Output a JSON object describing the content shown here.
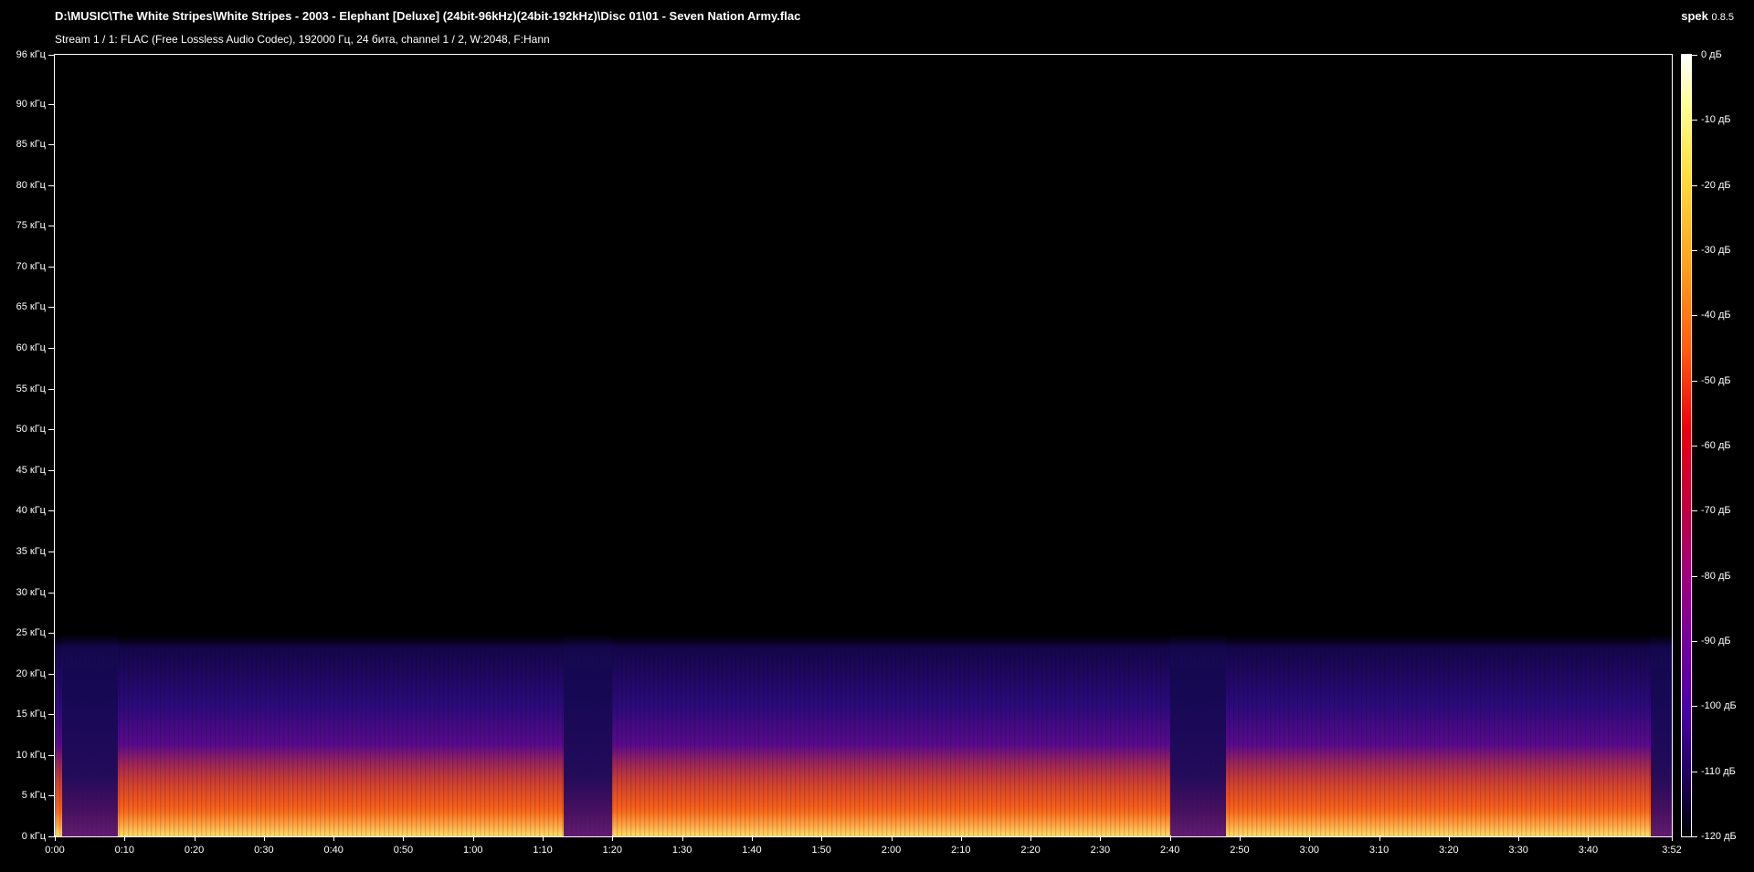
{
  "header": {
    "file_path": "D:\\MUSIC\\The White Stripes\\White Stripes - 2003 - Elephant [Deluxe] (24bit-96kHz)(24bit-192kHz)\\Disc 01\\01 - Seven Nation Army.flac",
    "stream_info": "Stream 1 / 1: FLAC (Free Lossless Audio Codec), 192000 Гц, 24 бита, channel 1 / 2, W:2048, F:Hann",
    "app_name": "spek",
    "app_version": "0.8.5"
  },
  "chart_data": {
    "type": "heatmap",
    "title": "",
    "xlabel": "",
    "ylabel": "",
    "x_ticks": [
      "0:00",
      "0:10",
      "0:20",
      "0:30",
      "0:40",
      "0:50",
      "1:00",
      "1:10",
      "1:20",
      "1:30",
      "1:40",
      "1:50",
      "2:00",
      "2:10",
      "2:20",
      "2:30",
      "2:40",
      "2:50",
      "3:00",
      "3:10",
      "3:20",
      "3:30",
      "3:40",
      "3:52"
    ],
    "x_tick_seconds": [
      0,
      10,
      20,
      30,
      40,
      50,
      60,
      70,
      80,
      90,
      100,
      110,
      120,
      130,
      140,
      150,
      160,
      170,
      180,
      190,
      200,
      210,
      220,
      232
    ],
    "xlim_seconds": [
      0,
      232
    ],
    "y_ticks": [
      "0 кГц",
      "5 кГц",
      "10 кГц",
      "15 кГц",
      "20 кГц",
      "25 кГц",
      "30 кГц",
      "35 кГц",
      "40 кГц",
      "45 кГц",
      "50 кГц",
      "55 кГц",
      "60 кГц",
      "65 кГц",
      "70 кГц",
      "75 кГц",
      "80 кГц",
      "85 кГц",
      "90 кГц",
      "96 кГц"
    ],
    "y_tick_khz": [
      0,
      5,
      10,
      15,
      20,
      25,
      30,
      35,
      40,
      45,
      50,
      55,
      60,
      65,
      70,
      75,
      80,
      85,
      90,
      96
    ],
    "ylim_khz": [
      0,
      96
    ],
    "content_cutoff_khz": 25,
    "quiet_sections_seconds": [
      [
        1,
        9
      ],
      [
        73,
        80
      ],
      [
        160,
        168
      ],
      [
        229,
        232
      ]
    ],
    "colorbar": {
      "labels": [
        "0 дБ",
        "-10 дБ",
        "-20 дБ",
        "-30 дБ",
        "-40 дБ",
        "-50 дБ",
        "-60 дБ",
        "-70 дБ",
        "-80 дБ",
        "-90 дБ",
        "-100 дБ",
        "-110 дБ",
        "-120 дБ"
      ],
      "values_db": [
        0,
        -10,
        -20,
        -30,
        -40,
        -50,
        -60,
        -70,
        -80,
        -90,
        -100,
        -110,
        -120
      ],
      "range_db": [
        -120,
        0
      ]
    }
  }
}
